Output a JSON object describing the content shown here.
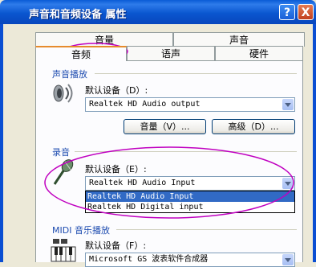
{
  "window": {
    "title": "声音和音频设备 属性",
    "help_label": "?",
    "close_label": "X"
  },
  "tabs": {
    "row1": [
      "音量",
      "声音"
    ],
    "row2": [
      "音频",
      "语声",
      "硬件"
    ],
    "active": "音频"
  },
  "sound_playback": {
    "group_label": "声音播放",
    "default_label": "默认设备（D）:",
    "selected": "Realtek HD Audio output",
    "volume_button": "音量（V）...",
    "advanced_button": "高级（D）..."
  },
  "recording": {
    "group_label": "录音",
    "default_label": "默认设备（E）:",
    "selected": "Realtek HD Audio Input",
    "options": [
      "Realtek HD Audio Input",
      "Realtek HD Digital input"
    ]
  },
  "midi": {
    "group_label": "MIDI 音乐播放",
    "default_label": "默认设备（F）:",
    "selected": "Microsoft GS 波表软件合成器"
  },
  "annotations": {
    "ellipse_color": "#C000C0"
  }
}
